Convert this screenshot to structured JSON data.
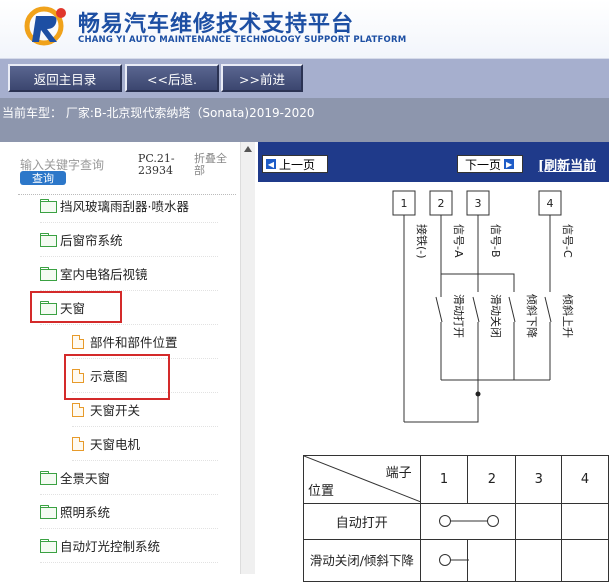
{
  "header": {
    "title_cn": "畅易汽车维修技术支持平台",
    "title_en": "CHANG YI AUTO MAINTENANCE TECHNOLOGY SUPPORT PLATFORM"
  },
  "toolbar": {
    "home_label": "返回主目录",
    "back_label": "<<后退.",
    "forward_label": ">>前进"
  },
  "car": {
    "label": "当前车型： 厂家:B-北京现代索纳塔（Sonata)2019-2020"
  },
  "left": {
    "search_placeholder": "输入关键字查询",
    "search_button": "查询",
    "pc_code": "PC.21-23934",
    "collapse_all": "折叠全部",
    "tree": [
      {
        "label": "挡风玻璃雨刮器·喷水器",
        "type": "folder"
      },
      {
        "label": "后窗帘系统",
        "type": "folder"
      },
      {
        "label": "室内电铬后视镜",
        "type": "folder"
      },
      {
        "label": "天窗",
        "type": "folder"
      },
      {
        "label": "部件和部件位置",
        "type": "file"
      },
      {
        "label": "示意图",
        "type": "file"
      },
      {
        "label": "天窗开关",
        "type": "file"
      },
      {
        "label": "天窗电机",
        "type": "file"
      },
      {
        "label": "全景天窗",
        "type": "folder"
      },
      {
        "label": "照明系统",
        "type": "folder"
      },
      {
        "label": "自动灯光控制系统",
        "type": "folder"
      }
    ]
  },
  "right": {
    "prev_page": "上一页",
    "next_page": "下一页",
    "refresh": "[刷新当前"
  },
  "diagram": {
    "terminals": [
      "1",
      "2",
      "3",
      "4"
    ],
    "signals": [
      "接铁(-)",
      "信号-A",
      "信号-B",
      "信号-C"
    ],
    "switches": [
      "滑动打开",
      "滑动关闭",
      "倾斜下降",
      "倾斜上升"
    ],
    "table": {
      "header_top": "端子",
      "header_bottom": "位置",
      "columns": [
        "1",
        "2",
        "3",
        "4"
      ],
      "rows": [
        "自动打开",
        "滑动关闭/倾斜下降"
      ]
    }
  }
}
